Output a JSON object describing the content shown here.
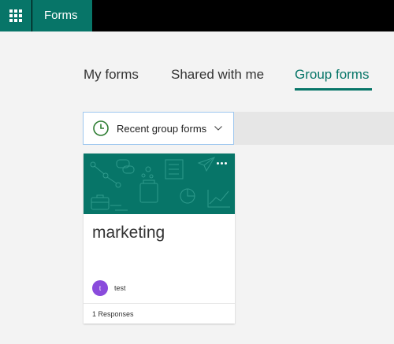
{
  "header": {
    "app_name": "Forms",
    "launcher_icon": "app-launcher-waffle-icon"
  },
  "tabs": [
    {
      "label": "My forms",
      "active": false
    },
    {
      "label": "Shared with me",
      "active": false
    },
    {
      "label": "Group forms",
      "active": true
    }
  ],
  "filter": {
    "selected": "Recent group forms",
    "icon": "clock-icon"
  },
  "form_card": {
    "title": "marketing",
    "owner_initial": "t",
    "owner_name": "test",
    "responses_text": "1 Responses",
    "more_icon": "ellipsis-icon"
  },
  "colors": {
    "brand": "#077568",
    "topbar": "#000000",
    "avatar": "#8a4bdc",
    "page_bg": "#f3f3f3",
    "dropdown_border": "#9ec7ef"
  }
}
